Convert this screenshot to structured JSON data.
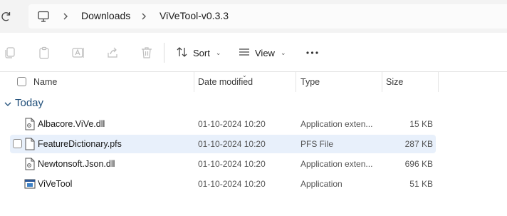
{
  "address_bar": {
    "breadcrumbs": [
      "Downloads",
      "ViVeTool-v0.3.3"
    ]
  },
  "toolbar": {
    "sort_label": "Sort",
    "view_label": "View"
  },
  "columns": {
    "name": "Name",
    "date_modified": "Date modified",
    "type": "Type",
    "size": "Size"
  },
  "group": {
    "label": "Today"
  },
  "files": [
    {
      "name": "Albacore.ViVe.dll",
      "date": "01-10-2024 10:20",
      "type": "Application exten...",
      "size": "15 KB",
      "icon": "dll-file-icon"
    },
    {
      "name": "FeatureDictionary.pfs",
      "date": "01-10-2024 10:20",
      "type": "PFS File",
      "size": "287 KB",
      "icon": "generic-file-icon",
      "selected": true
    },
    {
      "name": "Newtonsoft.Json.dll",
      "date": "01-10-2024 10:20",
      "type": "Application exten...",
      "size": "696 KB",
      "icon": "dll-file-icon"
    },
    {
      "name": "ViVeTool",
      "date": "01-10-2024 10:20",
      "type": "Application",
      "size": "51 KB",
      "icon": "application-icon"
    }
  ],
  "colors": {
    "accent": "#1f4e79",
    "selected_row": "#e8f0fb",
    "address_bg": "#f3f3f3"
  }
}
